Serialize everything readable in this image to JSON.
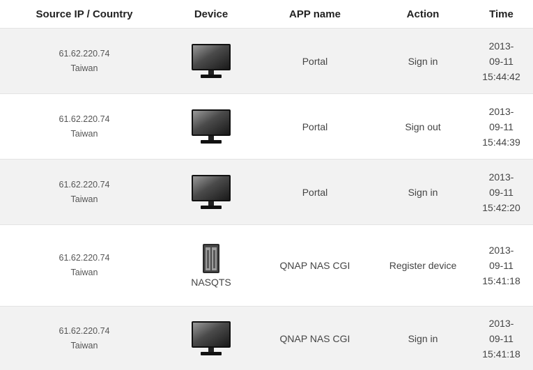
{
  "columns": {
    "source": "Source IP / Country",
    "device": "Device",
    "app": "APP name",
    "action": "Action",
    "time": "Time"
  },
  "rows": [
    {
      "ip": "61.62.220.74",
      "country": "Taiwan",
      "device_icon": "monitor-icon",
      "device_label": "",
      "app": "Portal",
      "action": "Sign in",
      "time": "2013-\n09-11\n15:44:42"
    },
    {
      "ip": "61.62.220.74",
      "country": "Taiwan",
      "device_icon": "monitor-icon",
      "device_label": "",
      "app": "Portal",
      "action": "Sign out",
      "time": "2013-\n09-11\n15:44:39"
    },
    {
      "ip": "61.62.220.74",
      "country": "Taiwan",
      "device_icon": "monitor-icon",
      "device_label": "",
      "app": "Portal",
      "action": "Sign in",
      "time": "2013-\n09-11\n15:42:20"
    },
    {
      "ip": "61.62.220.74",
      "country": "Taiwan",
      "device_icon": "nas-icon",
      "device_label": "NASQTS",
      "app": "QNAP NAS CGI",
      "action": "Register device",
      "time": "2013-\n09-11\n15:41:18"
    },
    {
      "ip": "61.62.220.74",
      "country": "Taiwan",
      "device_icon": "monitor-icon",
      "device_label": "",
      "app": "QNAP NAS CGI",
      "action": "Sign in",
      "time": "2013-\n09-11\n15:41:18"
    }
  ],
  "colors": {
    "row_shaded": "#f2f2f2",
    "row_plain": "#ffffff",
    "border": "#e3e3e3"
  }
}
